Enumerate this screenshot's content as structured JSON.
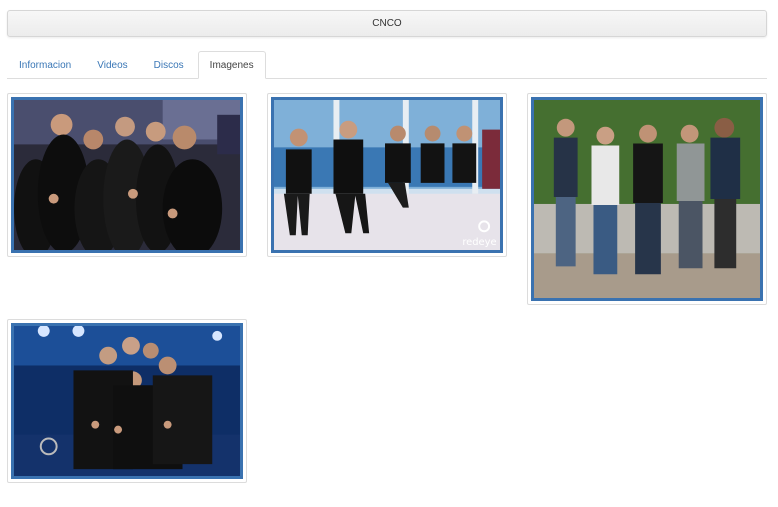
{
  "header": {
    "title": "CNCO"
  },
  "tabs": [
    {
      "label": "Informacion",
      "active": false
    },
    {
      "label": "Videos",
      "active": false
    },
    {
      "label": "Discos",
      "active": false
    },
    {
      "label": "Imagenes",
      "active": true
    }
  ],
  "gallery": {
    "images": [
      {
        "name": "group-photo-party"
      },
      {
        "name": "group-photo-interview",
        "watermark": "redeye"
      },
      {
        "name": "group-photo-hedge"
      },
      {
        "name": "group-photo-stage"
      }
    ]
  },
  "colors": {
    "link": "#3a77b6",
    "frame": "#3a72b0"
  }
}
